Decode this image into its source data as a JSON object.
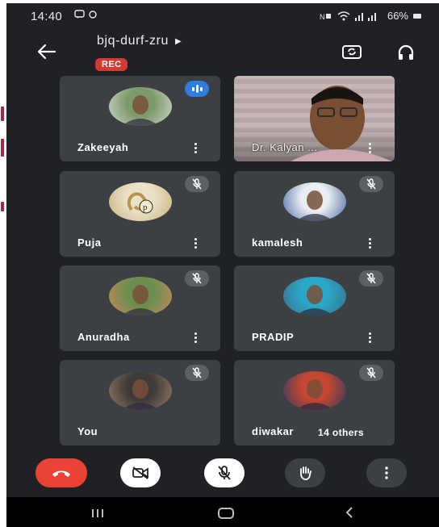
{
  "status_bar": {
    "time": "14:40",
    "left_icons": [
      "message-icon",
      "sync-icon"
    ],
    "right_text": "66%"
  },
  "header": {
    "meeting_code": "bjq-durf-zru",
    "rec_label": "REC"
  },
  "participants": [
    {
      "name": "Zakeeyah",
      "state": "speaking",
      "type": "avatar",
      "avatar_colors": [
        "#7d9a6c",
        "#cfd6c9"
      ]
    },
    {
      "name": "Dr. Kalyan ...",
      "state": "video",
      "type": "video"
    },
    {
      "name": "Puja",
      "state": "muted",
      "type": "avatar",
      "avatar_colors": [
        "#e9e2c8",
        "#c8b17a"
      ]
    },
    {
      "name": "kamalesh",
      "state": "muted",
      "type": "avatar",
      "avatar_colors": [
        "#e9eef2",
        "#4a6aa0"
      ]
    },
    {
      "name": "Anuradha",
      "state": "muted",
      "type": "avatar",
      "avatar_colors": [
        "#6b8e4e",
        "#c98a5a"
      ]
    },
    {
      "name": "PRADIP",
      "state": "muted",
      "type": "avatar",
      "avatar_colors": [
        "#2aa8c9",
        "#3c6c8a"
      ]
    },
    {
      "name": "You",
      "state": "muted",
      "type": "avatar",
      "avatar_colors": [
        "#3d3b3a",
        "#9a7a62"
      ]
    },
    {
      "name": "diwakar",
      "state": "muted",
      "type": "avatar",
      "avatar_colors": [
        "#c7462f",
        "#2a3b64"
      ]
    }
  ],
  "others_chip": "14 others",
  "controls": {
    "end_call": "phone-hangup-icon",
    "camera": "camera-off-icon",
    "mic": "mic-off-icon",
    "hand": "raise-hand-icon",
    "more": "more-vert-icon"
  },
  "colors": {
    "background": "#1f2125",
    "tile": "#3c4043",
    "end_call": "#ea4335",
    "rec": "#d33a34",
    "speaking": "#2f7de0"
  }
}
